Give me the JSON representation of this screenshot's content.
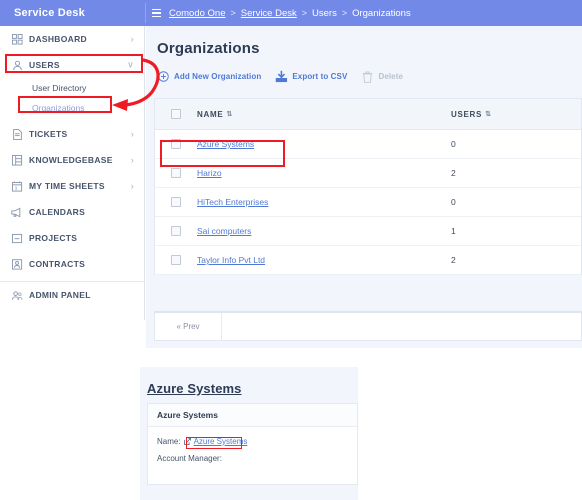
{
  "brand": {
    "title": "Service Desk"
  },
  "breadcrumb": {
    "items": [
      "Comodo One",
      "Service Desk",
      "Users",
      "Organizations"
    ],
    "separator": ">"
  },
  "sidebar": {
    "items": [
      {
        "label": "DASHBOARD",
        "icon": "dashboard-icon",
        "chevron": "›",
        "expanded": false
      },
      {
        "label": "USERS",
        "icon": "user-icon",
        "chevron": "∨",
        "expanded": true
      },
      {
        "label": "TICKETS",
        "icon": "ticket-icon",
        "chevron": "›",
        "expanded": false
      },
      {
        "label": "KNOWLEDGEBASE",
        "icon": "knowledgebase-icon",
        "chevron": "›",
        "expanded": false
      },
      {
        "label": "MY TIME SHEETS",
        "icon": "calendar-icon",
        "chevron": "›",
        "expanded": false
      },
      {
        "label": "CALENDARS",
        "icon": "megaphone-icon",
        "chevron": "",
        "expanded": false
      },
      {
        "label": "PROJECTS",
        "icon": "projects-icon",
        "chevron": "",
        "expanded": false
      },
      {
        "label": "CONTRACTS",
        "icon": "contracts-icon",
        "chevron": "",
        "expanded": false
      }
    ],
    "users_submenu": [
      {
        "label": "User Directory",
        "active": false
      },
      {
        "label": "Organizations",
        "active": true
      }
    ],
    "admin": {
      "label": "ADMIN PANEL",
      "icon": "admin-icon"
    }
  },
  "main": {
    "title": "Organizations",
    "toolbar": {
      "add_label": "Add New Organization",
      "export_label": "Export to CSV",
      "delete_label": "Delete"
    },
    "table": {
      "columns": [
        {
          "key": "name",
          "label": "NAME",
          "sort": "⇅"
        },
        {
          "key": "users",
          "label": "USERS",
          "sort": "⇅"
        }
      ],
      "rows": [
        {
          "name": "Azure Systems",
          "users": "0"
        },
        {
          "name": "Harizo",
          "users": "2"
        },
        {
          "name": "HiTech Enterprises",
          "users": "0"
        },
        {
          "name": "Sai computers",
          "users": "1"
        },
        {
          "name": "Taylor Info Pvt Ltd",
          "users": "2"
        }
      ]
    },
    "pagination": {
      "prev_label": "« Prev"
    }
  },
  "detail": {
    "title": "Azure Systems",
    "card_header": "Azure Systems",
    "name_label": "Name:",
    "name_value": "Azure Systems",
    "account_manager_label": "Account Manager:"
  },
  "colors": {
    "topbar": "#7289e8",
    "accent_link": "#4f79d6",
    "page_bg": "#f2f6fc",
    "annotation_red": "#ee1b24",
    "text_dark": "#2d3b54"
  }
}
